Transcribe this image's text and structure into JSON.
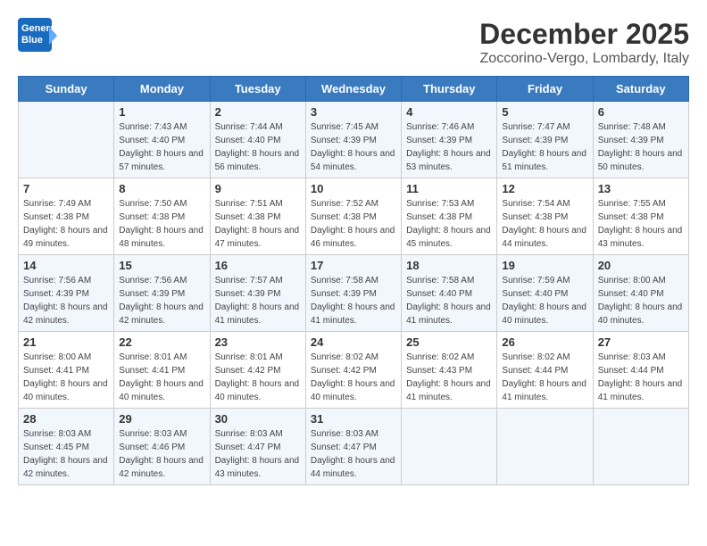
{
  "header": {
    "logo_line1": "General",
    "logo_line2": "Blue",
    "month": "December 2025",
    "location": "Zoccorino-Vergo, Lombardy, Italy"
  },
  "weekdays": [
    "Sunday",
    "Monday",
    "Tuesday",
    "Wednesday",
    "Thursday",
    "Friday",
    "Saturday"
  ],
  "weeks": [
    [
      null,
      {
        "day": 1,
        "sunrise": "7:43 AM",
        "sunset": "4:40 PM",
        "daylight": "8 hours and 57 minutes."
      },
      {
        "day": 2,
        "sunrise": "7:44 AM",
        "sunset": "4:40 PM",
        "daylight": "8 hours and 56 minutes."
      },
      {
        "day": 3,
        "sunrise": "7:45 AM",
        "sunset": "4:39 PM",
        "daylight": "8 hours and 54 minutes."
      },
      {
        "day": 4,
        "sunrise": "7:46 AM",
        "sunset": "4:39 PM",
        "daylight": "8 hours and 53 minutes."
      },
      {
        "day": 5,
        "sunrise": "7:47 AM",
        "sunset": "4:39 PM",
        "daylight": "8 hours and 51 minutes."
      },
      {
        "day": 6,
        "sunrise": "7:48 AM",
        "sunset": "4:39 PM",
        "daylight": "8 hours and 50 minutes."
      }
    ],
    [
      {
        "day": 7,
        "sunrise": "7:49 AM",
        "sunset": "4:38 PM",
        "daylight": "8 hours and 49 minutes."
      },
      {
        "day": 8,
        "sunrise": "7:50 AM",
        "sunset": "4:38 PM",
        "daylight": "8 hours and 48 minutes."
      },
      {
        "day": 9,
        "sunrise": "7:51 AM",
        "sunset": "4:38 PM",
        "daylight": "8 hours and 47 minutes."
      },
      {
        "day": 10,
        "sunrise": "7:52 AM",
        "sunset": "4:38 PM",
        "daylight": "8 hours and 46 minutes."
      },
      {
        "day": 11,
        "sunrise": "7:53 AM",
        "sunset": "4:38 PM",
        "daylight": "8 hours and 45 minutes."
      },
      {
        "day": 12,
        "sunrise": "7:54 AM",
        "sunset": "4:38 PM",
        "daylight": "8 hours and 44 minutes."
      },
      {
        "day": 13,
        "sunrise": "7:55 AM",
        "sunset": "4:38 PM",
        "daylight": "8 hours and 43 minutes."
      }
    ],
    [
      {
        "day": 14,
        "sunrise": "7:56 AM",
        "sunset": "4:39 PM",
        "daylight": "8 hours and 42 minutes."
      },
      {
        "day": 15,
        "sunrise": "7:56 AM",
        "sunset": "4:39 PM",
        "daylight": "8 hours and 42 minutes."
      },
      {
        "day": 16,
        "sunrise": "7:57 AM",
        "sunset": "4:39 PM",
        "daylight": "8 hours and 41 minutes."
      },
      {
        "day": 17,
        "sunrise": "7:58 AM",
        "sunset": "4:39 PM",
        "daylight": "8 hours and 41 minutes."
      },
      {
        "day": 18,
        "sunrise": "7:58 AM",
        "sunset": "4:40 PM",
        "daylight": "8 hours and 41 minutes."
      },
      {
        "day": 19,
        "sunrise": "7:59 AM",
        "sunset": "4:40 PM",
        "daylight": "8 hours and 40 minutes."
      },
      {
        "day": 20,
        "sunrise": "8:00 AM",
        "sunset": "4:40 PM",
        "daylight": "8 hours and 40 minutes."
      }
    ],
    [
      {
        "day": 21,
        "sunrise": "8:00 AM",
        "sunset": "4:41 PM",
        "daylight": "8 hours and 40 minutes."
      },
      {
        "day": 22,
        "sunrise": "8:01 AM",
        "sunset": "4:41 PM",
        "daylight": "8 hours and 40 minutes."
      },
      {
        "day": 23,
        "sunrise": "8:01 AM",
        "sunset": "4:42 PM",
        "daylight": "8 hours and 40 minutes."
      },
      {
        "day": 24,
        "sunrise": "8:02 AM",
        "sunset": "4:42 PM",
        "daylight": "8 hours and 40 minutes."
      },
      {
        "day": 25,
        "sunrise": "8:02 AM",
        "sunset": "4:43 PM",
        "daylight": "8 hours and 41 minutes."
      },
      {
        "day": 26,
        "sunrise": "8:02 AM",
        "sunset": "4:44 PM",
        "daylight": "8 hours and 41 minutes."
      },
      {
        "day": 27,
        "sunrise": "8:03 AM",
        "sunset": "4:44 PM",
        "daylight": "8 hours and 41 minutes."
      }
    ],
    [
      {
        "day": 28,
        "sunrise": "8:03 AM",
        "sunset": "4:45 PM",
        "daylight": "8 hours and 42 minutes."
      },
      {
        "day": 29,
        "sunrise": "8:03 AM",
        "sunset": "4:46 PM",
        "daylight": "8 hours and 42 minutes."
      },
      {
        "day": 30,
        "sunrise": "8:03 AM",
        "sunset": "4:47 PM",
        "daylight": "8 hours and 43 minutes."
      },
      {
        "day": 31,
        "sunrise": "8:03 AM",
        "sunset": "4:47 PM",
        "daylight": "8 hours and 44 minutes."
      },
      null,
      null,
      null
    ]
  ]
}
